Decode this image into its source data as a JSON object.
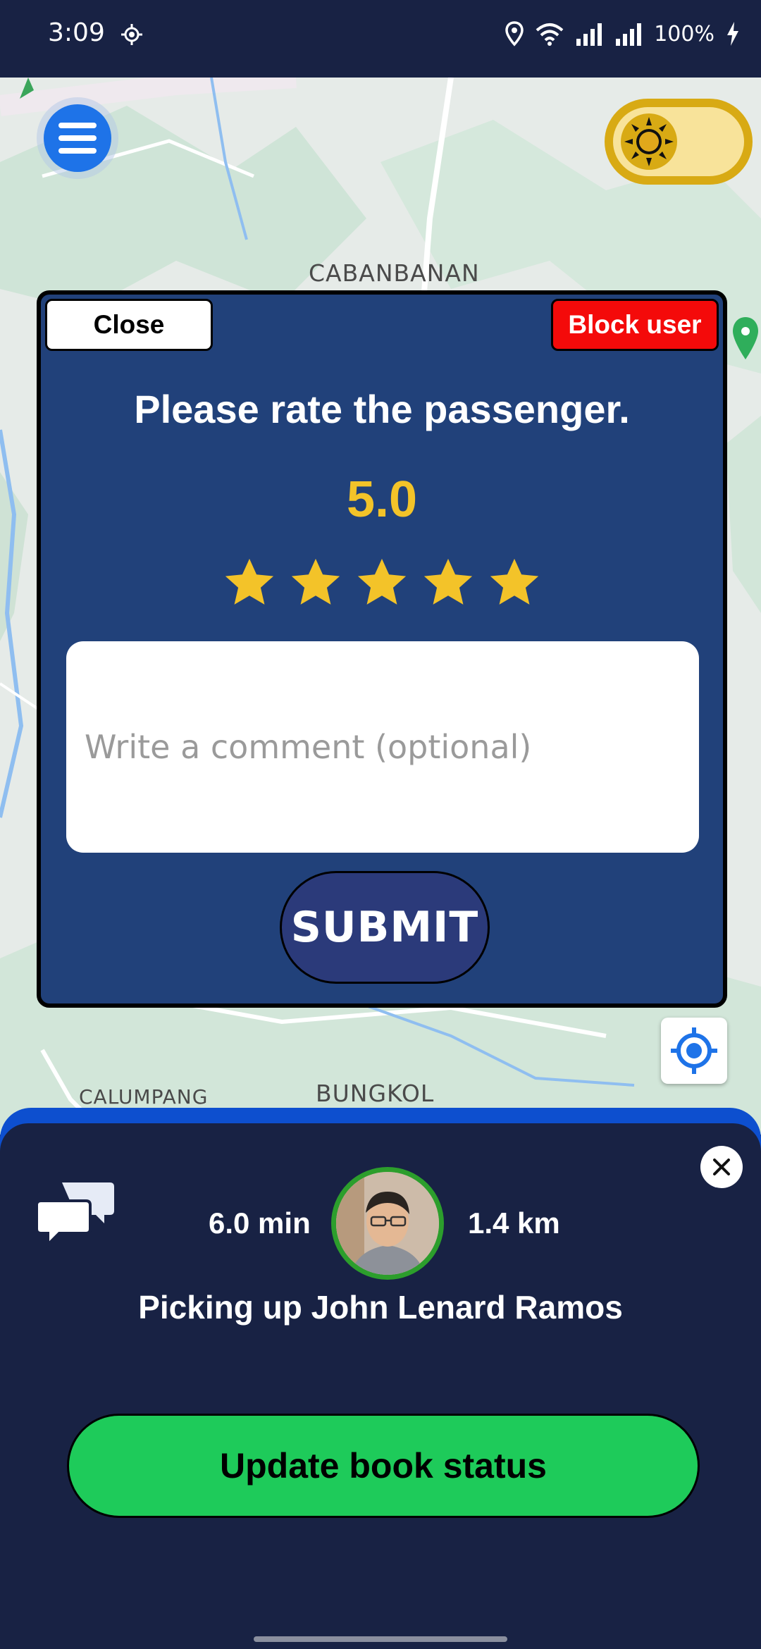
{
  "status_bar": {
    "time": "3:09",
    "battery": "100%"
  },
  "map": {
    "labels": [
      "CABANBANAN",
      "CALUMPANG",
      "BUNGKOL"
    ]
  },
  "dialog": {
    "close_label": "Close",
    "block_label": "Block user",
    "title": "Please rate the passenger.",
    "rating_value": "5.0",
    "rating_stars": 5,
    "rating_max": 5,
    "comment_placeholder": "Write a comment (optional)",
    "submit_label": "SUBMIT"
  },
  "trip": {
    "eta": "6.0 min",
    "distance": "1.4 km",
    "pickup_text": "Picking up John Lenard Ramos",
    "update_label": "Update book status"
  },
  "colors": {
    "background": "#182244",
    "dialog_bg": "#21417a",
    "star": "#f3c329",
    "block": "#f40a0a",
    "update": "#1ecb5a",
    "accent": "#1e73e8"
  }
}
